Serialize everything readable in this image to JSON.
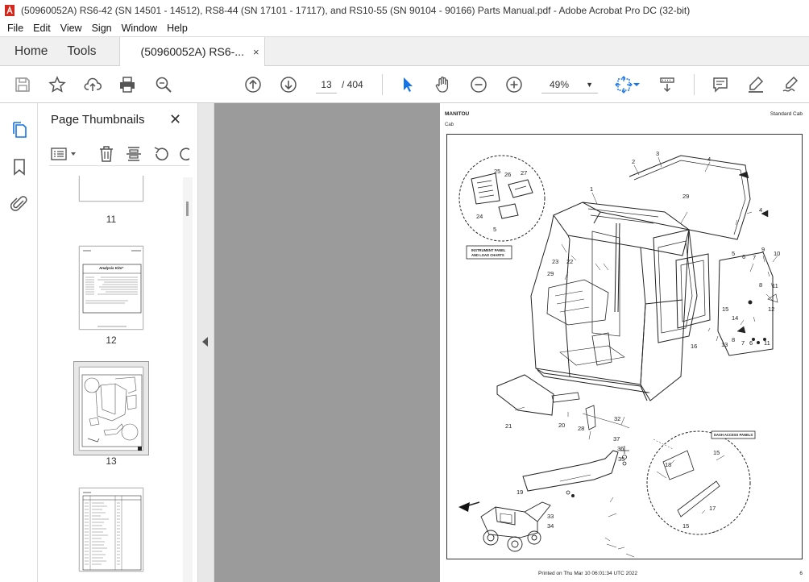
{
  "window": {
    "title": "(50960052A) RS6-42 (SN 14501 - 14512), RS8-44 (SN 17101 - 17117), and RS10-55 (SN 90104 - 90166) Parts Manual.pdf - Adobe Acrobat Pro DC (32-bit)"
  },
  "menu": [
    "File",
    "Edit",
    "View",
    "Sign",
    "Window",
    "Help"
  ],
  "tabs": {
    "home": "Home",
    "tools": "Tools",
    "document": "(50960052A) RS6-...",
    "close": "×"
  },
  "toolbar": {
    "current_page": "13",
    "page_total": "/  404",
    "zoom": "49%"
  },
  "sidebar": {
    "title": "Page Thumbnails",
    "close": "✕",
    "thumbnails": [
      {
        "label": "11"
      },
      {
        "label": "12"
      },
      {
        "label": "13"
      },
      {
        "label": ""
      }
    ],
    "thumb12_heading": "Analysis Kits*"
  },
  "page": {
    "header_left": "MANITOU",
    "header_sub": "Cab",
    "header_right": "Standard Cab",
    "footer": "Printed on   Thu Mar 10 06:01:34 UTC 2022",
    "page_number": "6",
    "box_instrument": [
      "INSTRUMENT PANEL",
      "AND LOAD CHARTS"
    ],
    "box_dash": "DASH ACCESS PANELS",
    "callouts": [
      "1",
      "2",
      "3",
      "4",
      "4",
      "5",
      "5",
      "6",
      "6",
      "7",
      "7",
      "8",
      "8",
      "9",
      "10",
      "11",
      "11",
      "12",
      "13",
      "14",
      "15",
      "15",
      "15",
      "16",
      "17",
      "18",
      "19",
      "20",
      "21",
      "22",
      "23",
      "24",
      "25",
      "26",
      "27",
      "28",
      "29",
      "29",
      "32",
      "33",
      "34",
      "35",
      "36",
      "37"
    ]
  }
}
